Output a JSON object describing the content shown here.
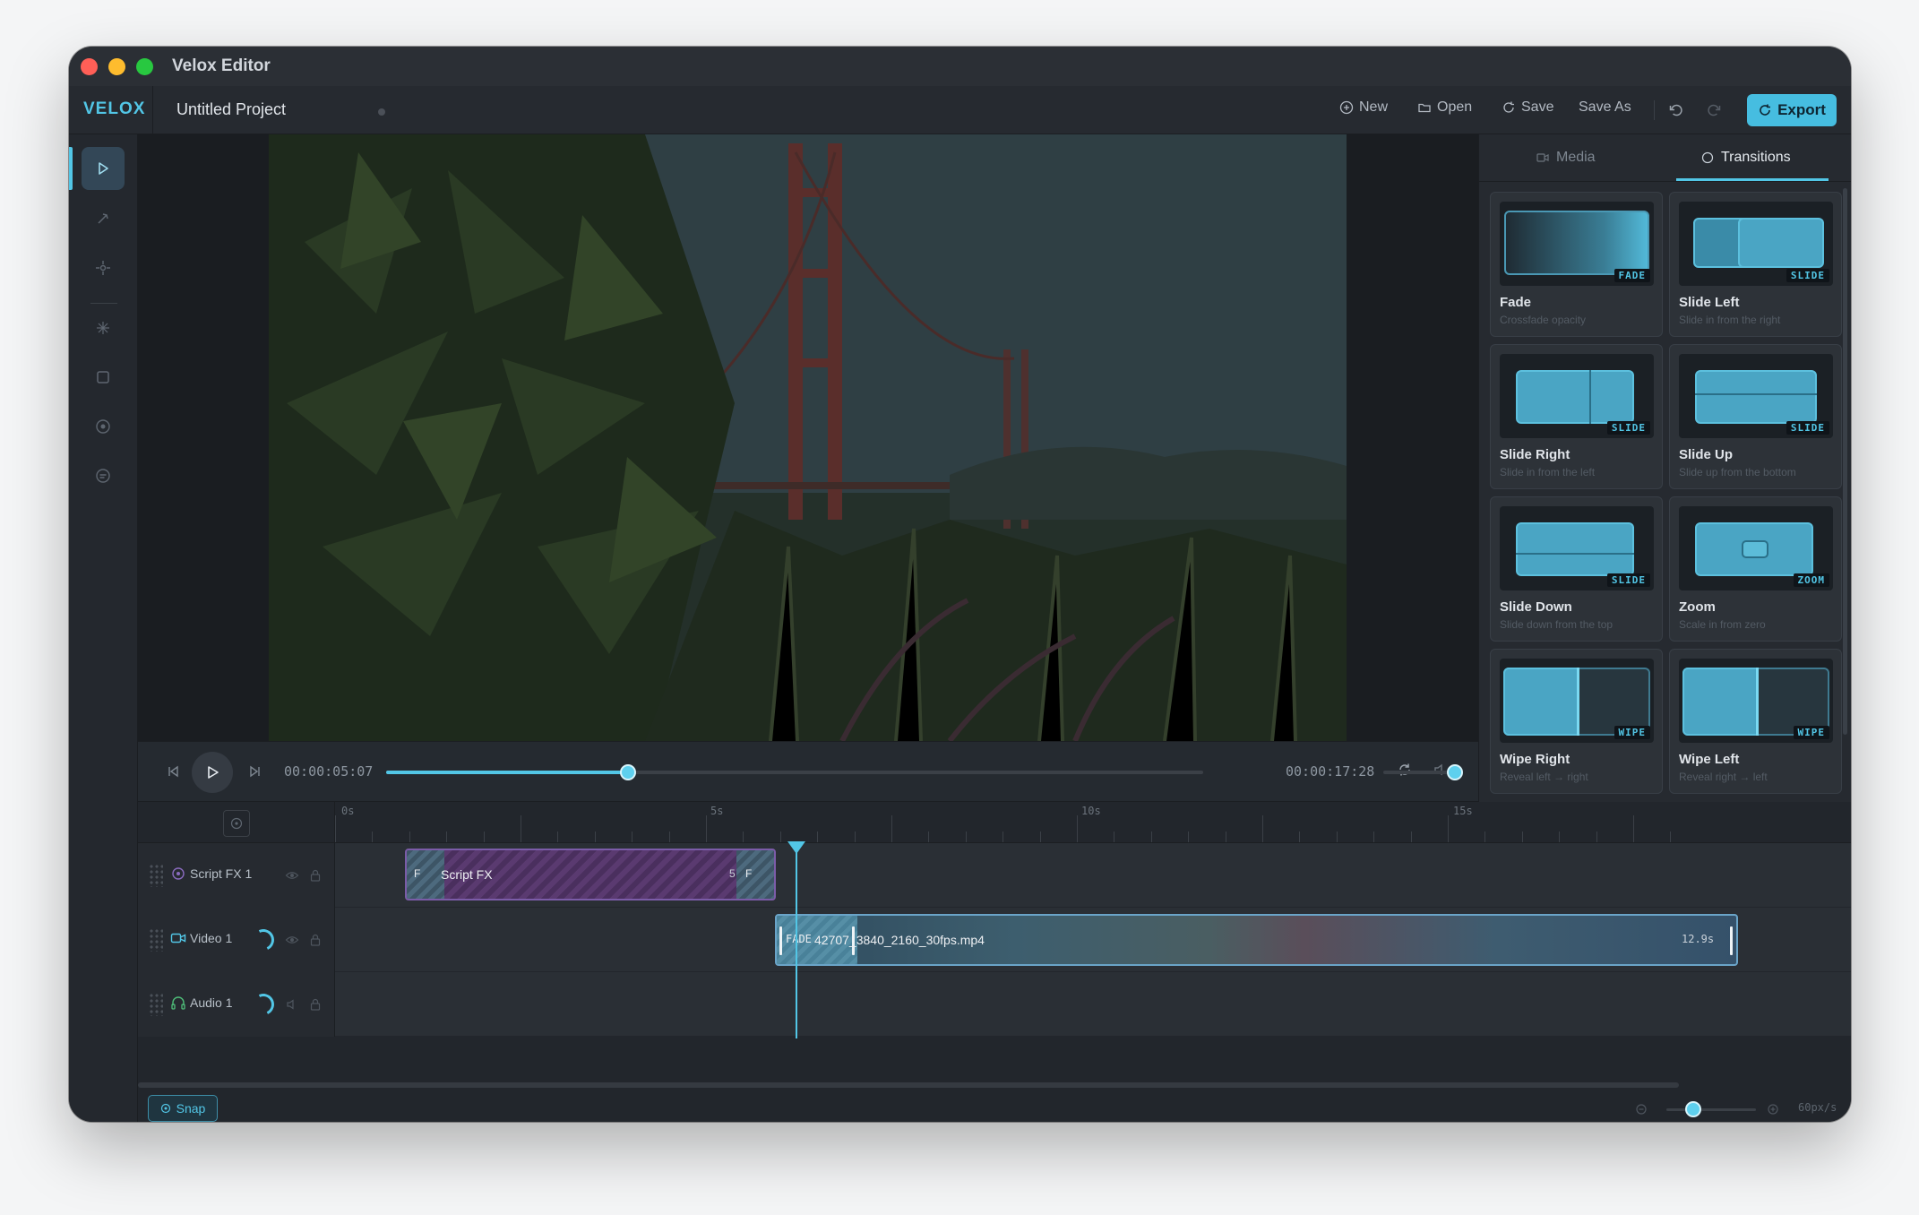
{
  "window": {
    "title": "Velox Editor"
  },
  "toolbar": {
    "brand": "VELOX",
    "project_title": "Untitled Project",
    "new_label": "New",
    "open_label": "Open",
    "save_label": "Save",
    "save_as_label": "Save As",
    "export_label": "Export",
    "accent_color": "#52c6e6"
  },
  "tools": [
    "select-tool",
    "trim-tool",
    "crop-tool",
    "effects-tool",
    "shape-tool",
    "record-tool",
    "caption-tool"
  ],
  "transport": {
    "current_time": "00:00:05:07",
    "total_time": "00:00:17:28",
    "progress": 0.296,
    "volume": 1.0
  },
  "panel": {
    "tabs": [
      {
        "label": "Media",
        "active": false
      },
      {
        "label": "Transitions",
        "active": true
      }
    ],
    "transitions": [
      {
        "title": "Fade",
        "desc": "Crossfade opacity",
        "badge": "FADE"
      },
      {
        "title": "Slide Left",
        "desc": "Slide in from the right",
        "badge": "SLIDE"
      },
      {
        "title": "Slide Right",
        "desc": "Slide in from the left",
        "badge": "SLIDE"
      },
      {
        "title": "Slide Up",
        "desc": "Slide up from the bottom",
        "badge": "SLIDE"
      },
      {
        "title": "Slide Down",
        "desc": "Slide down from the top",
        "badge": "SLIDE"
      },
      {
        "title": "Zoom",
        "desc": "Scale in from zero",
        "badge": "ZOOM"
      },
      {
        "title": "Wipe Right",
        "desc": "Reveal left → right",
        "badge": "WIPE"
      },
      {
        "title": "Wipe Left",
        "desc": "Reveal right → left",
        "badge": "WIPE"
      }
    ]
  },
  "timeline": {
    "ruler_labels": [
      "0s",
      "5s",
      "10s",
      "15s"
    ],
    "tracks": [
      {
        "name": "Script FX 1"
      },
      {
        "name": "Video 1"
      },
      {
        "name": "Audio 1"
      }
    ],
    "fx_clip": {
      "label": "Script FX",
      "left_tag": "F",
      "right_tag": "5",
      "right_tag2": "F"
    },
    "video_clip": {
      "fade_tag": "FADE",
      "label": "42707_3840_2160_30fps.mp4",
      "duration": "12.9s"
    },
    "snap_label": "Snap",
    "zoom_label": "60px/s",
    "zoom_level": 0.3
  }
}
